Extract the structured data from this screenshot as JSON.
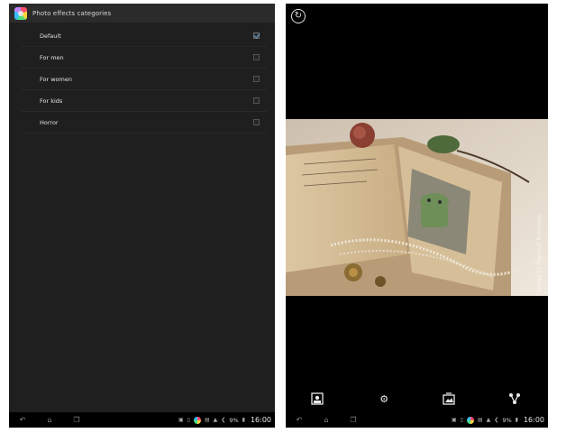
{
  "left_screen": {
    "app_title": "Photo effects categories",
    "app_icon": "photo-effects-app-icon",
    "items": [
      {
        "label": "Default",
        "checked": true
      },
      {
        "label": "For men",
        "checked": false
      },
      {
        "label": "For women",
        "checked": false
      },
      {
        "label": "For kids",
        "checked": false
      },
      {
        "label": "Horror",
        "checked": false
      }
    ],
    "status": {
      "battery": "9%",
      "clock": "16:00"
    }
  },
  "right_screen": {
    "watermark": "Vintage by Raphaël Rousseau",
    "status": {
      "battery": "9%",
      "clock": "16:00"
    },
    "toolbar_icons": [
      "image-icon",
      "gear-icon",
      "image-gallery-icon",
      "share-icon"
    ]
  },
  "nav_icons": [
    "back-icon",
    "home-icon",
    "recent-apps-icon"
  ],
  "colors": {
    "screen_bg": "#1f1f1f",
    "check_accent": "#6ea8d6",
    "photo_bg": "#e9e1d3"
  }
}
